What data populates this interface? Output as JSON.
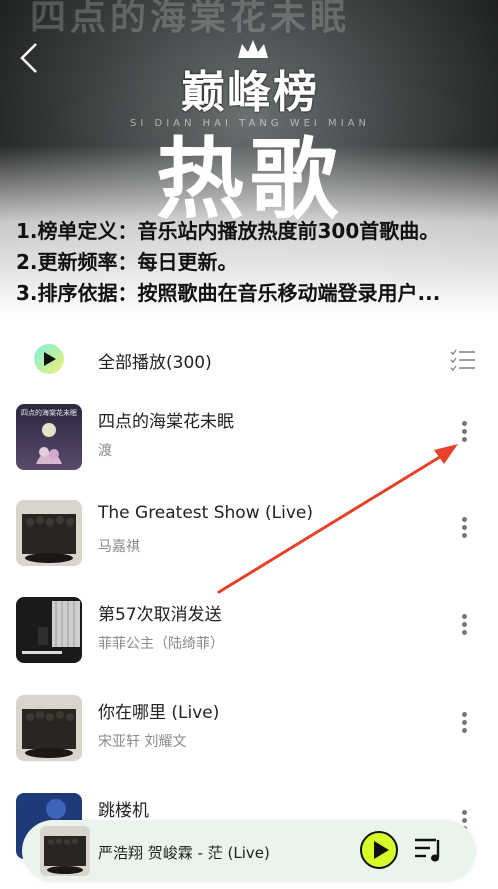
{
  "header": {
    "bg_text": "四点的海棠花未眠",
    "logo_text": "巅峰榜",
    "subline": "SI DIAN   HAI TANG   WEI MIAN",
    "big_title": "热歌",
    "description": [
      "1.榜单定义：音乐站内播放热度前300首歌曲。",
      "2.更新频率：每日更新。",
      "3.排序依据：按照歌曲在音乐移动端登录用户..."
    ]
  },
  "play_all": {
    "label": "全部播放(300)"
  },
  "songs": [
    {
      "title": "四点的海棠花未眠",
      "artist": "渡",
      "cover_text": "四点的海棠花未眠"
    },
    {
      "title": "The Greatest Show (Live)",
      "artist": "马嘉祺"
    },
    {
      "title": "第57次取消发送",
      "artist": "菲菲公主（陆绮菲）"
    },
    {
      "title": "你在哪里 (Live)",
      "artist": "宋亚轩 刘耀文"
    },
    {
      "title": "跳楼机",
      "artist": ""
    }
  ],
  "mini_player": {
    "title": "严浩翔 贺峻霖 - 茫 (Live)"
  },
  "colors": {
    "accent_green": "#d6ff2a",
    "annotation_red": "#e8402a",
    "player_bg": "#eaf4ec"
  }
}
